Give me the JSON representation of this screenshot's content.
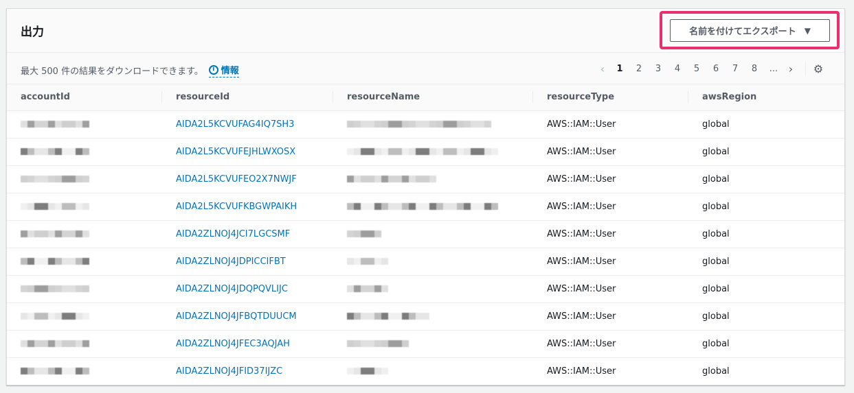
{
  "panel": {
    "title": "出力",
    "export_button": {
      "label": "名前を付けてエクスポート",
      "caret": "▼"
    },
    "toolbar": {
      "note": "最大 500 件の結果をダウンロードできます。",
      "info_label": "情報",
      "info_icon": "i"
    },
    "pagination": {
      "prev_icon": "‹",
      "pages": [
        "1",
        "2",
        "3",
        "4",
        "5",
        "6",
        "7",
        "8"
      ],
      "ellipsis": "...",
      "next_icon": "›",
      "current": "1",
      "settings_icon": "⚙"
    }
  },
  "table": {
    "columns": [
      "accountId",
      "resourceId",
      "resourceName",
      "resourceType",
      "awsRegion"
    ],
    "rows": [
      {
        "resourceId": "AIDA2L5KCVUFAG4IQ7SH3",
        "resourceType": "AWS::IAM::User",
        "awsRegion": "global"
      },
      {
        "resourceId": "AIDA2L5KCVUFEJHLWXOSX",
        "resourceType": "AWS::IAM::User",
        "awsRegion": "global"
      },
      {
        "resourceId": "AIDA2L5KCVUFEO2X7NWJF",
        "resourceType": "AWS::IAM::User",
        "awsRegion": "global"
      },
      {
        "resourceId": "AIDA2L5KCVUFKBGWPAIKH",
        "resourceType": "AWS::IAM::User",
        "awsRegion": "global"
      },
      {
        "resourceId": "AIDA2ZLNOJ4JCI7LGCSMF",
        "resourceType": "AWS::IAM::User",
        "awsRegion": "global"
      },
      {
        "resourceId": "AIDA2ZLNOJ4JDPICCIFBT",
        "resourceType": "AWS::IAM::User",
        "awsRegion": "global"
      },
      {
        "resourceId": "AIDA2ZLNOJ4JDQPQVLIJC",
        "resourceType": "AWS::IAM::User",
        "awsRegion": "global"
      },
      {
        "resourceId": "AIDA2ZLNOJ4JFBQTDUUCM",
        "resourceType": "AWS::IAM::User",
        "awsRegion": "global"
      },
      {
        "resourceId": "AIDA2ZLNOJ4JFEC3AQJAH",
        "resourceType": "AWS::IAM::User",
        "awsRegion": "global"
      },
      {
        "resourceId": "AIDA2ZLNOJ4JFID37IJZC",
        "resourceType": "AWS::IAM::User",
        "awsRegion": "global"
      }
    ]
  },
  "colors": {
    "highlight": "#e8306e",
    "link": "#0073bb"
  }
}
